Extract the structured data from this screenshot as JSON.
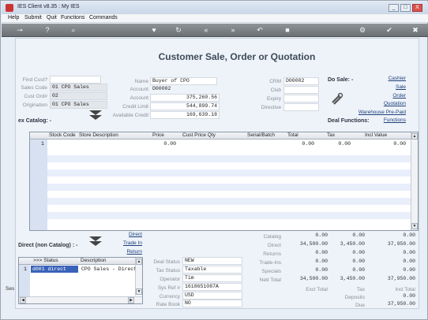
{
  "window": {
    "title": "IES Client v8.35 : My IES",
    "controls": {
      "minimize": "_",
      "maximize": "□",
      "close": "X"
    }
  },
  "menu": [
    "Help",
    "Submit",
    "Quit",
    "Functions",
    "Commands"
  ],
  "toolbar": {
    "icons": [
      "key-icon",
      "help-icon",
      "search-icon",
      "heart-icon",
      "refresh-icon",
      "first-icon",
      "last-icon",
      "back-icon",
      "stop-icon",
      "settings-icon",
      "confirm-icon",
      "close-icon"
    ]
  },
  "header": {
    "title": "Customer Sale, Order or Quotation"
  },
  "left_form": {
    "find_cust_label": "Find Cust?",
    "find_cust_value": "",
    "sales_code_label": "Sales Code",
    "sales_code_value": "01 CPO Sales",
    "cust_ord_label": "Cust Ord#",
    "cust_ord_value": "02",
    "origination_label": "Origination",
    "origination_value": "01 CPO Sales"
  },
  "mid_form": {
    "name_label": "Name",
    "name_value": "Buyer of CPO",
    "account_label1": "Account",
    "account_value1": "D00002",
    "account_label2": "Account",
    "account_value2": "375,260.56",
    "credit_limit_label": "Credit Limit",
    "credit_limit_value": "544,899.74",
    "available_credit_label": "Available Credit",
    "available_credit_value": "169,639.18"
  },
  "crm_form": {
    "crm_label": "CRM",
    "crm_value": "D00002",
    "club_label": "Club",
    "club_value": "",
    "expiry_label": "Expiry",
    "expiry_value": "",
    "directive_label": "Directive",
    "directive_value": ""
  },
  "do_sale": {
    "label": "Do Sale: -",
    "links": [
      "Cashier",
      "Sale",
      "Order",
      "Quotation",
      "Warehouse Pre-Paid"
    ],
    "functions_label": "Deal Functions:",
    "functions_link": "Functions"
  },
  "ex_catalog": {
    "label": "ex Catalog: -",
    "columns": [
      "Stock Code",
      "Store Description",
      "Price",
      "Cust Price Qty",
      "Serial/Batch",
      "Total",
      "Tax",
      "Incl Value"
    ],
    "rows": [
      {
        "num": "1",
        "stock_code": "",
        "description": "",
        "price": "0.00",
        "cust_price_qty": "",
        "serial": "",
        "total": "0.00",
        "tax": "0.00",
        "incl": "0.00"
      }
    ]
  },
  "direct": {
    "label": "Direct (non Catalog) : -",
    "links": [
      "Direct",
      "Trade In",
      "Return"
    ],
    "columns": [
      ">>> Status",
      "Description"
    ],
    "rows": [
      {
        "num": "1",
        "status": "d001 direct",
        "description": "CPO Sales - Direct"
      }
    ]
  },
  "deal_info": {
    "deal_status_label": "Deal Status",
    "deal_status_value": "NEW",
    "tax_status_label": "Tax Status",
    "tax_status_value": "Taxable",
    "operator_label": "Operator",
    "operator_value": "Tim",
    "sys_ref_label": "Sys Ref #",
    "sys_ref_value": "1618651087A",
    "currency_label": "Currency",
    "currency_value": "USD",
    "rate_book_label": "Rate Book",
    "rate_book_value": "NO"
  },
  "totals": {
    "rows": [
      {
        "label": "Catalog",
        "c1": "0.00",
        "c2": "0.00",
        "c3": "0.00"
      },
      {
        "label": "Direct",
        "c1": "34,500.00",
        "c2": "3,450.00",
        "c3": "37,950.00"
      },
      {
        "label": "Returns",
        "c1": "0.00",
        "c2": "0.00",
        "c3": "0.00"
      },
      {
        "label": "Trade-Ins",
        "c1": "0.00",
        "c2": "0.00",
        "c3": "0.00"
      },
      {
        "label": "Specials",
        "c1": "0.00",
        "c2": "0.00",
        "c3": "0.00"
      },
      {
        "label": "Nett Total",
        "c1": "34,500.00",
        "c2": "3,450.00",
        "c3": "37,950.00"
      }
    ],
    "excl_total_label": "Excl Total",
    "tax_label": "Tax",
    "incl_total_label": "Incl Total",
    "deposits_label": "Deposits",
    "deposits_value": "0.00",
    "due_label": "Due",
    "due_value": "37,950.00"
  },
  "side_tab": "Ses"
}
